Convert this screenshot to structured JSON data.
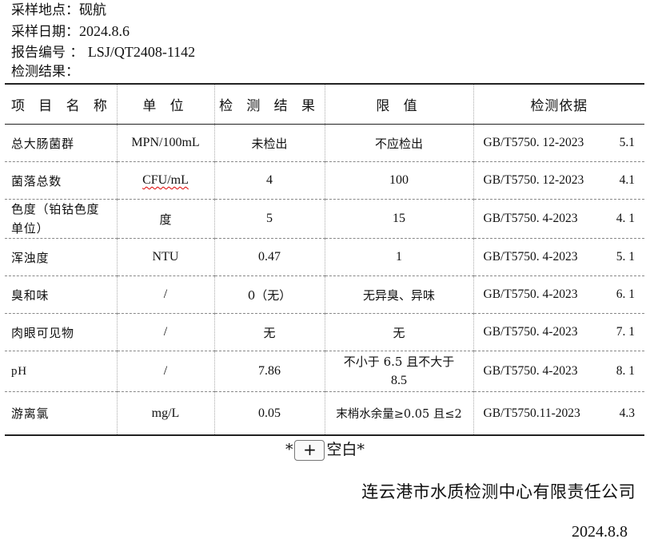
{
  "header": {
    "location_label": "采样地点：",
    "location_value": "砚航",
    "date_label": "采样日期：",
    "date_value": "2024.8.6",
    "report_label": "报告编号 ：",
    "report_value": "LSJ/QT2408-1142",
    "results_label": "检测结果："
  },
  "table": {
    "columns": [
      "项 目 名 称",
      "单 位",
      "检 测 结 果",
      "限 值",
      "检测依据"
    ],
    "rows": [
      {
        "name": "总大肠菌群",
        "unit": "MPN/100mL",
        "result": "未检出",
        "limit": "不应检出",
        "basis": "GB/T5750. 12-2023",
        "section": "5.1"
      },
      {
        "name": "菌落总数",
        "unit": "CFU/mL",
        "result": "4",
        "limit": "100",
        "basis": "GB/T5750. 12-2023",
        "section": "4.1"
      },
      {
        "name_line1": "色度（铂钴色度",
        "name_line2": "单位）",
        "unit": "度",
        "result": "5",
        "limit": "15",
        "basis": "GB/T5750. 4-2023",
        "section": "4. 1"
      },
      {
        "name": "浑浊度",
        "unit": "NTU",
        "result": "0.47",
        "limit": "1",
        "basis": "GB/T5750. 4-2023",
        "section": "5. 1"
      },
      {
        "name": "臭和味",
        "unit": "/",
        "result": "0（无）",
        "limit": "无异臭、异味",
        "basis": "GB/T5750. 4-2023",
        "section": "6. 1"
      },
      {
        "name": "肉眼可见物",
        "unit": "/",
        "result": "无",
        "limit": "无",
        "basis": "GB/T5750. 4-2023",
        "section": "7. 1"
      },
      {
        "name": "pH",
        "unit": "/",
        "result": "7.86",
        "limit_line1": "不小于 6.5 且不大于",
        "limit_line2": "8.5",
        "basis": "GB/T5750. 4-2023",
        "section": "8. 1"
      },
      {
        "name": "游离氯",
        "unit": "mg/L",
        "result": "0.05",
        "limit": "末梢水余量≥0.05 且≤2",
        "basis": "GB/T5750.11-2023",
        "section": "4.3"
      }
    ]
  },
  "footer": {
    "blank_prefix": "*",
    "blank_button": "+",
    "blank_suffix": "空白*",
    "company": "连云港市水质检测中心有限责任公司",
    "date": "2024.8.8"
  }
}
